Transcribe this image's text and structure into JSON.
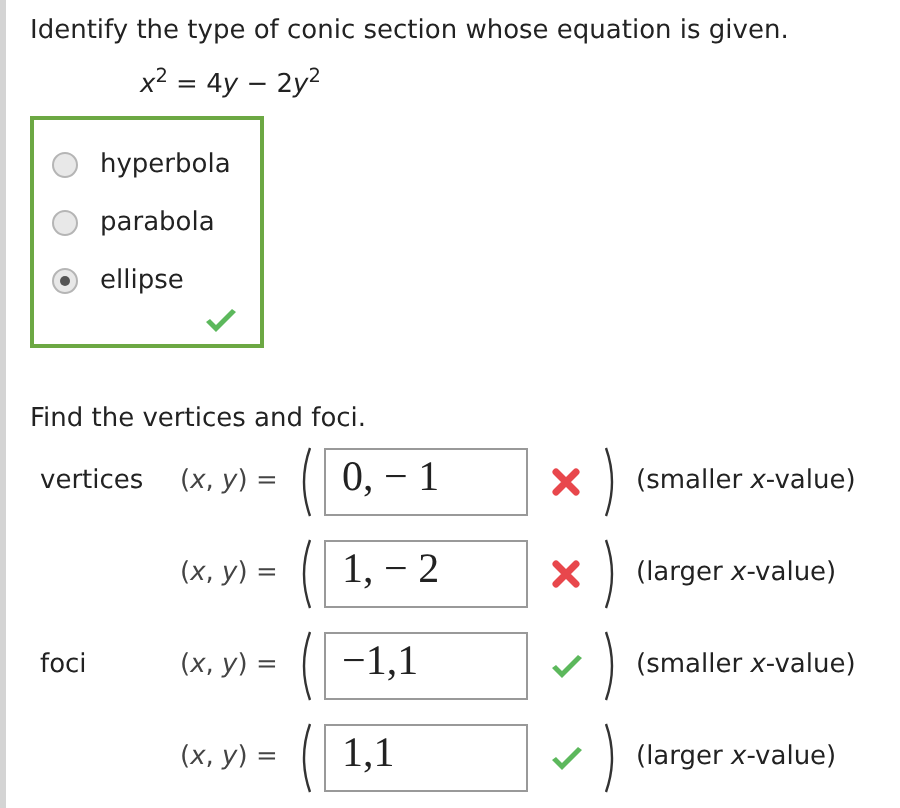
{
  "part_a": {
    "prompt": "Identify the type of conic section whose equation is given.",
    "equation": [
      {
        "kind": "var",
        "text": "x"
      },
      {
        "kind": "sup",
        "text": "2"
      },
      {
        "kind": "plain",
        "text": " = 4"
      },
      {
        "kind": "var",
        "text": "y"
      },
      {
        "kind": "plain",
        "text": " − 2"
      },
      {
        "kind": "var",
        "text": "y"
      },
      {
        "kind": "sup",
        "text": "2"
      }
    ],
    "options": [
      {
        "label": "hyperbola",
        "selected": false
      },
      {
        "label": "parabola",
        "selected": false
      },
      {
        "label": "ellipse",
        "selected": true
      }
    ],
    "correct": true
  },
  "part_b": {
    "prompt": "Find the vertices and foci.",
    "rows": [
      {
        "label": "vertices",
        "lhs": "(*x*, *y*) =",
        "value": "0, − 1",
        "correct": false,
        "note": "(smaller *x*-value)"
      },
      {
        "lhs": "(*x*, *y*) =",
        "value": "1, − 2",
        "correct": false,
        "note": "(larger *x*-value)"
      },
      {
        "label": "foci",
        "lhs": "(*x*, *y*) =",
        "value": "−1,1",
        "correct": true,
        "note": "(smaller *x*-value)"
      },
      {
        "lhs": "(*x*, *y*) =",
        "value": "1,1",
        "correct": true,
        "note": "(larger *x*-value)"
      }
    ]
  }
}
